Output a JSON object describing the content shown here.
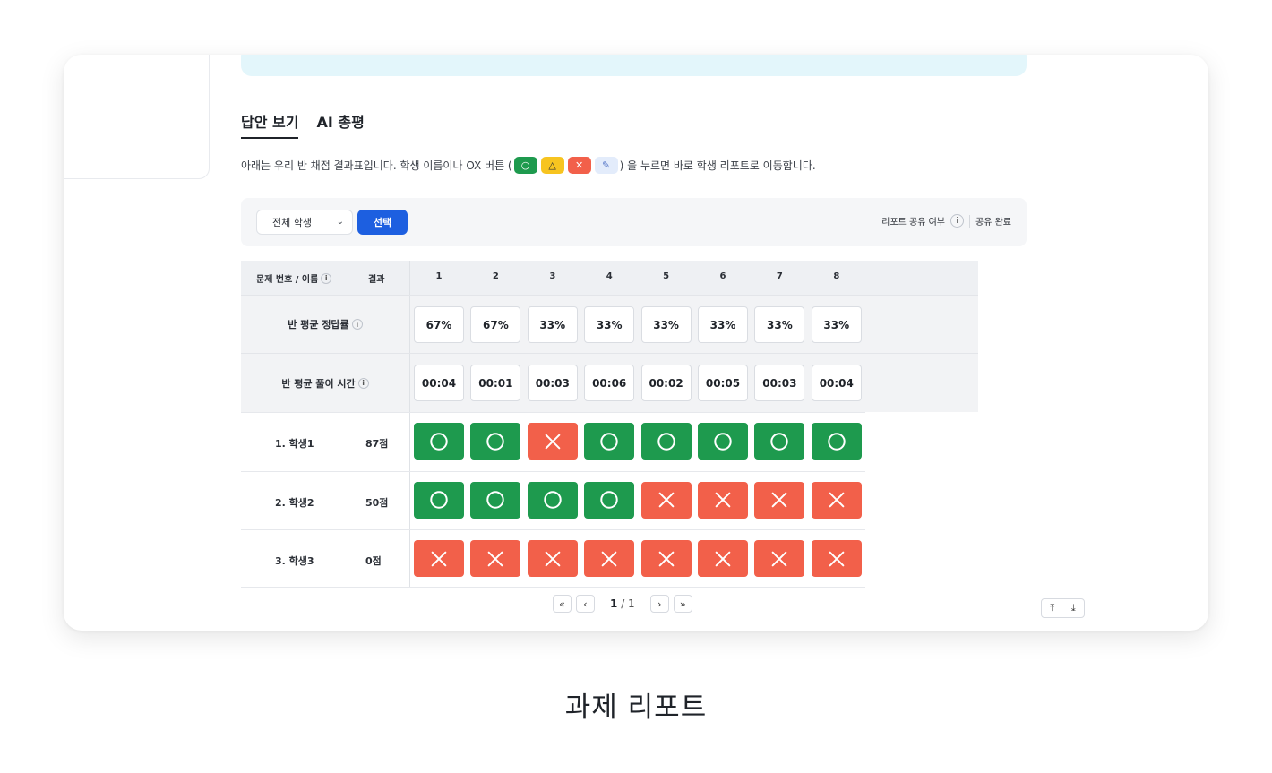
{
  "tabs": [
    {
      "label": "답안 보기",
      "active": true
    },
    {
      "label": "AI 총평",
      "active": false
    }
  ],
  "description": {
    "before": "아래는 우리 반 채점 결과표입니다. 학생 이름이나 OX 버튼 (",
    "after": ") 을 누르면 바로 학생 리포트로 이동합니다.",
    "legend_icons": [
      "circle-icon",
      "triangle-icon",
      "x-icon",
      "pencil-icon"
    ]
  },
  "toolbar": {
    "filter_value": "전체 학생",
    "select_button": "선택",
    "share_label": "리포트 공유 여부",
    "info_glyph": "i",
    "share_status": "공유 완료"
  },
  "table": {
    "header_name": "문제 번호 / 이름",
    "header_result": "결과",
    "question_numbers": [
      "1",
      "2",
      "3",
      "4",
      "5",
      "6",
      "7",
      "8"
    ],
    "avg_correct_label": "반 평균 정답률",
    "avg_correct": [
      "67%",
      "67%",
      "33%",
      "33%",
      "33%",
      "33%",
      "33%",
      "33%"
    ],
    "avg_time_label": "반 평균 풀이 시간",
    "avg_time": [
      "00:04",
      "00:01",
      "00:03",
      "00:06",
      "00:02",
      "00:05",
      "00:03",
      "00:04"
    ],
    "students": [
      {
        "name": "1. 학생1",
        "score": "87점",
        "marks": [
          "O",
          "O",
          "X",
          "O",
          "O",
          "O",
          "O",
          "O"
        ]
      },
      {
        "name": "2. 학생2",
        "score": "50점",
        "marks": [
          "O",
          "O",
          "O",
          "O",
          "X",
          "X",
          "X",
          "X"
        ]
      },
      {
        "name": "3. 학생3",
        "score": "0점",
        "marks": [
          "X",
          "X",
          "X",
          "X",
          "X",
          "X",
          "X",
          "X"
        ]
      }
    ]
  },
  "pagination": {
    "current": "1",
    "total": "/ 1"
  },
  "caption": "과제 리포트",
  "colors": {
    "correct": "#1e9a4e",
    "wrong": "#f2604a",
    "partial": "#f7c420",
    "primary": "#1d5fe0"
  }
}
